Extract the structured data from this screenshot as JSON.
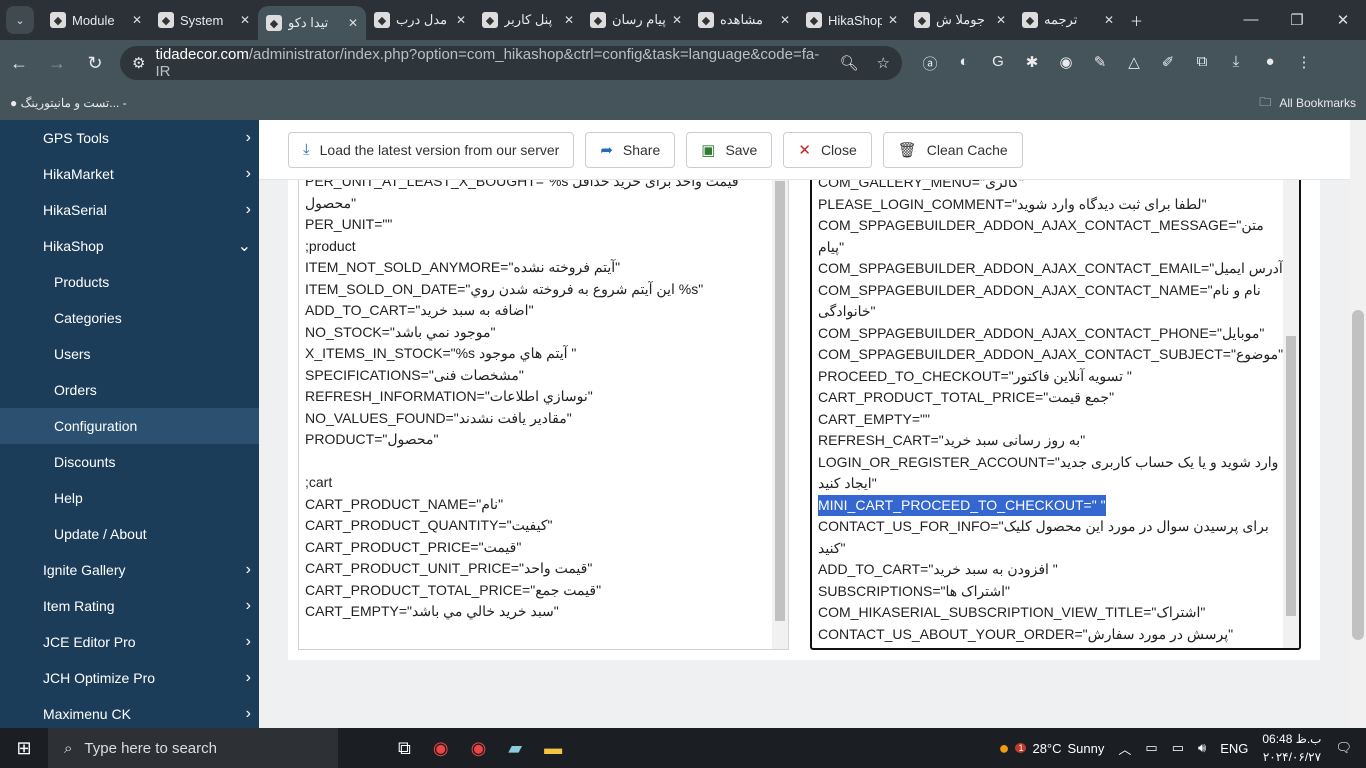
{
  "browser": {
    "tabs": [
      {
        "label": "Module",
        "icon": "joomla-icon"
      },
      {
        "label": "System",
        "icon": "joomla-icon"
      },
      {
        "label": "تیدا دکو",
        "icon": "joomla-icon",
        "active": true
      },
      {
        "label": "مدل درب",
        "icon": "site-icon"
      },
      {
        "label": "پنل کاربر",
        "icon": "site-icon"
      },
      {
        "label": "پیام رسان",
        "icon": "chrome-ext-icon"
      },
      {
        "label": "مشاهده",
        "icon": "r-logo-icon"
      },
      {
        "label": "HikaShop",
        "icon": "hikashop-icon"
      },
      {
        "label": "جوملا ش",
        "icon": "joomla-color-icon"
      },
      {
        "label": "ترجمه",
        "icon": "google-translate-icon"
      }
    ],
    "url_host": "tidadecor.com",
    "url_path": "/administrator/index.php?option=com_hikashop&ctrl=config&task=language&code=fa-IR",
    "bookmark": "تست و مانیتورینگ... -",
    "all_bookmarks": "All Bookmarks"
  },
  "sidebar": {
    "items": [
      {
        "label": "GPS Tools",
        "chev": "›"
      },
      {
        "label": "HikaMarket",
        "chev": "›"
      },
      {
        "label": "HikaSerial",
        "chev": "›"
      },
      {
        "label": "HikaShop",
        "chev": "⌄"
      },
      {
        "label": "Products",
        "sub": true
      },
      {
        "label": "Categories",
        "sub": true
      },
      {
        "label": "Users",
        "sub": true
      },
      {
        "label": "Orders",
        "sub": true
      },
      {
        "label": "Configuration",
        "sub": true,
        "active": true
      },
      {
        "label": "Discounts",
        "sub": true
      },
      {
        "label": "Help",
        "sub": true
      },
      {
        "label": "Update / About",
        "sub": true
      },
      {
        "label": "Ignite Gallery",
        "chev": "›"
      },
      {
        "label": "Item Rating",
        "chev": "›"
      },
      {
        "label": "JCE Editor Pro",
        "chev": "›"
      },
      {
        "label": "JCH Optimize Pro",
        "chev": "›"
      },
      {
        "label": "Maximenu CK",
        "chev": "›"
      }
    ]
  },
  "toolbar": {
    "load": "Load the latest version from our server",
    "share": "Share",
    "save": "Save",
    "close": "Close",
    "clean": "Clean Cache"
  },
  "left_editor": [
    "PER_UNIT_AT_LEAST_X_BOUGHT=\"%s قیمت واحد برای خرید حداقل",
    "محصول\"",
    "PER_UNIT=\"\"",
    ";product",
    "ITEM_NOT_SOLD_ANYMORE=\"آیتم فروخته نشده\"",
    "ITEM_SOLD_ON_DATE=\"این آیتم شروع به فروخته شدن روي %s\"",
    "ADD_TO_CART=\"اضافه به سبد خريد\"",
    "NO_STOCK=\"موجود نمي باشد\"",
    "X_ITEMS_IN_STOCK=\"%s آيتم هاي موجود \"",
    "SPECIFICATIONS=\"مشخصات فنی\"",
    "REFRESH_INFORMATION=\"نوسازي اطلاعات\"",
    "NO_VALUES_FOUND=\"مقادير يافت نشدند\"",
    "PRODUCT=\"محصول\"",
    "",
    ";cart",
    "CART_PRODUCT_NAME=\"نام\"",
    "CART_PRODUCT_QUANTITY=\"کیفیت\"",
    "CART_PRODUCT_PRICE=\"قیمت\"",
    "CART_PRODUCT_UNIT_PRICE=\"قیمت واحد\"",
    "CART_PRODUCT_TOTAL_PRICE=\"قیمت جمع\"",
    "CART_EMPTY=\"سبد خريد خالي مي باشد\""
  ],
  "right_editor": [
    "COM_GALLERY_MENU=\"گالری\"",
    "PLEASE_LOGIN_COMMENT=\"لطفا برای ثبت دیدگاه وارد شوید\"",
    "COM_SPPAGEBUILDER_ADDON_AJAX_CONTACT_MESSAGE=\"متن",
    "پیام\"",
    "COM_SPPAGEBUILDER_ADDON_AJAX_CONTACT_EMAIL=\"آدرس ایمیل\"",
    "COM_SPPAGEBUILDER_ADDON_AJAX_CONTACT_NAME=\"نام و نام",
    "خانوادگی\"",
    "COM_SPPAGEBUILDER_ADDON_AJAX_CONTACT_PHONE=\"موبایل\"",
    "COM_SPPAGEBUILDER_ADDON_AJAX_CONTACT_SUBJECT=\"موضوع\"",
    "PROCEED_TO_CHECKOUT=\"تسویه آنلاین فاکتور \"",
    "CART_PRODUCT_TOTAL_PRICE=\"جمع قیمت\"",
    "CART_EMPTY=\"\"",
    "REFRESH_CART=\"به روز رسانی سبد خرید\"",
    "LOGIN_OR_REGISTER_ACCOUNT=\"وارد شوید و یا یک حساب کاربری جدید",
    "ایجاد کنید\"",
    "MINI_CART_PROCEED_TO_CHECKOUT=\" \"",
    "CONTACT_US_FOR_INFO=\"برای پرسیدن سوال در مورد این محصول کلیک",
    "کنید\"",
    "ADD_TO_CART=\"افزودن به سبد خرید \"",
    "SUBSCRIPTIONS=\"اشتراک ها\"",
    "COM_HIKASERIAL_SUBSCRIPTION_VIEW_TITLE=\"اشتراک\"",
    "CONTACT_US_ABOUT_YOUR_ORDER=\"پرسش در مورد سفارش\""
  ],
  "right_selected_line": 15,
  "taskbar": {
    "search_placeholder": "Type here to search",
    "weather_badge": "1",
    "temp": "28°C",
    "weather": "Sunny",
    "lang": "ENG",
    "time": "06:48 ب.ظ",
    "date": "۲۰۲۴/۰۶/۲۷"
  }
}
